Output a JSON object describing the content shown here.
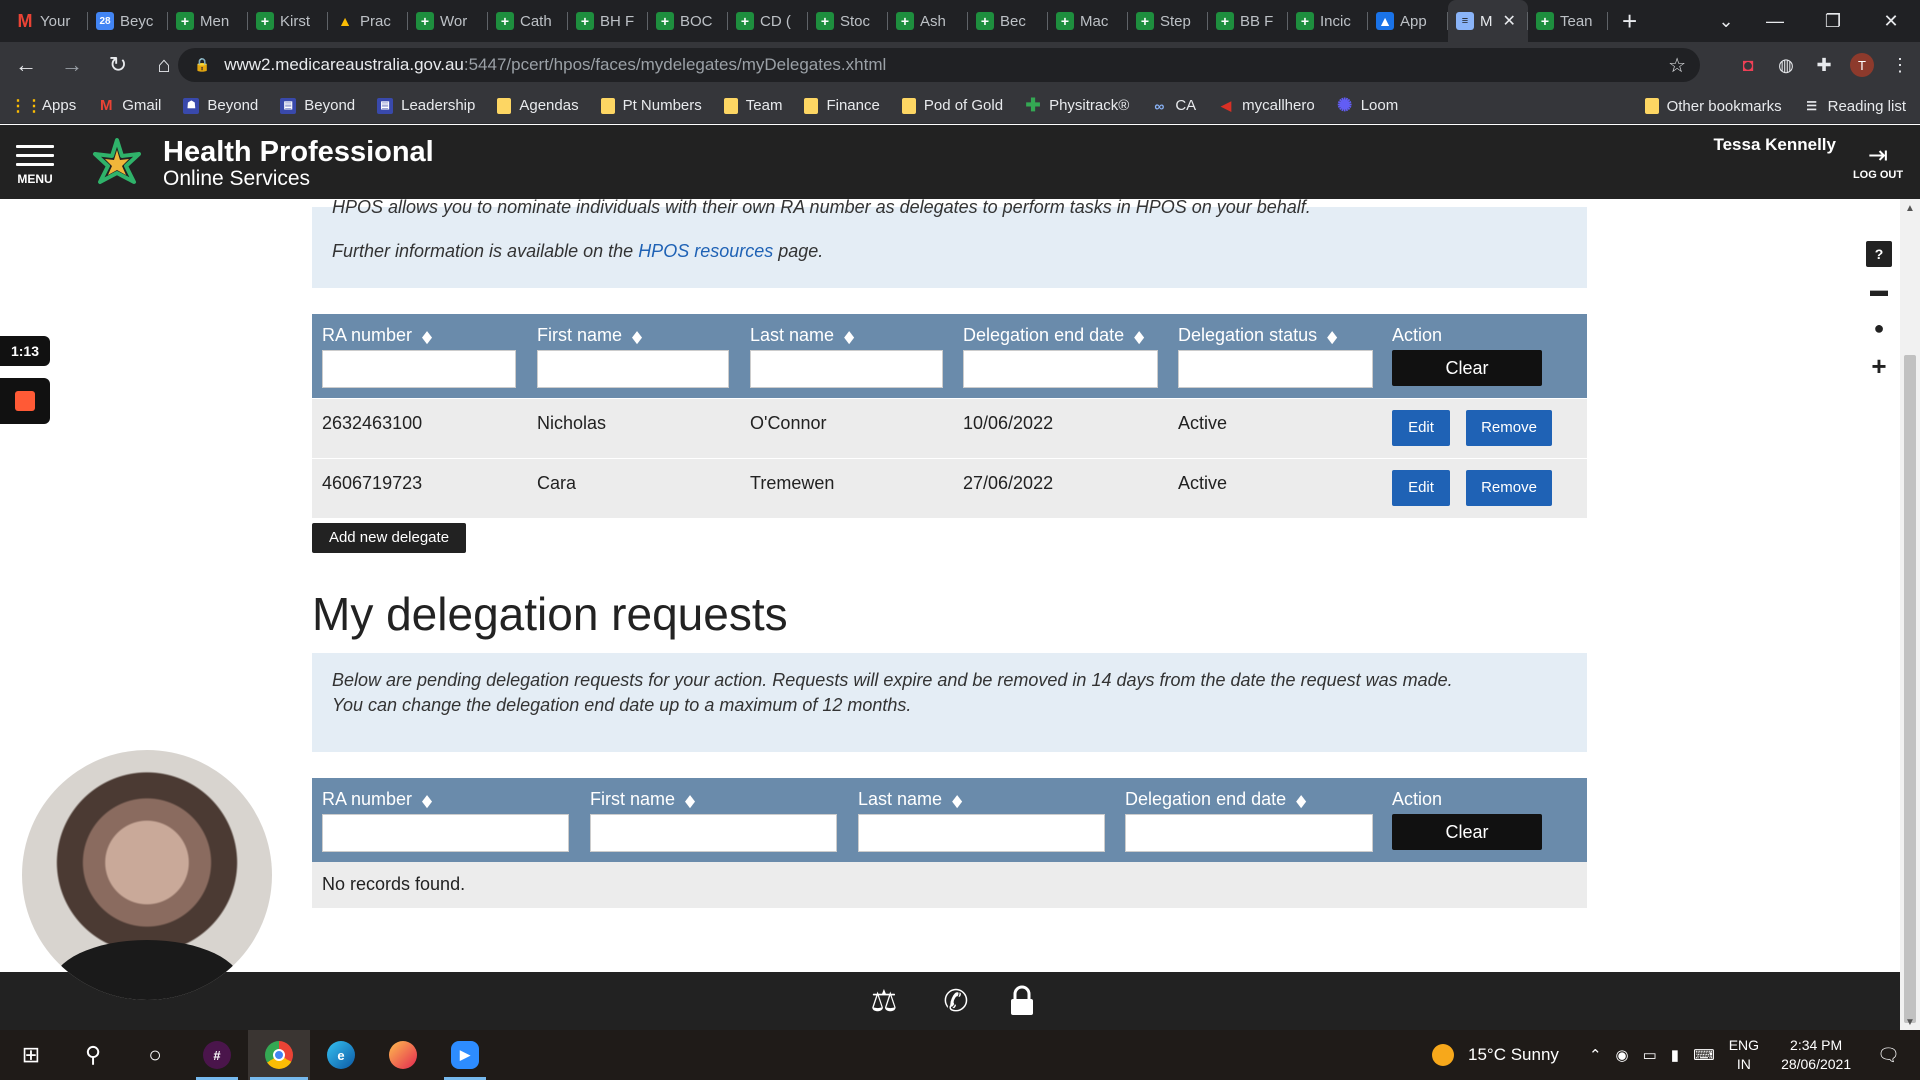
{
  "browser": {
    "tabs": [
      {
        "title": "Your",
        "icon": "gmail-icon"
      },
      {
        "title": "Beyc",
        "icon": "calendar-icon"
      },
      {
        "title": "Men",
        "icon": "cliniko-icon"
      },
      {
        "title": "Kirst",
        "icon": "cliniko-icon"
      },
      {
        "title": "Prac",
        "icon": "drive-icon"
      },
      {
        "title": "Wor",
        "icon": "cliniko-icon"
      },
      {
        "title": "Cath",
        "icon": "cliniko-icon"
      },
      {
        "title": "BH F",
        "icon": "cliniko-icon"
      },
      {
        "title": "BOC",
        "icon": "cliniko-icon"
      },
      {
        "title": "CD (",
        "icon": "cliniko-icon"
      },
      {
        "title": "Stoc",
        "icon": "cliniko-icon"
      },
      {
        "title": "Ash",
        "icon": "cliniko-icon"
      },
      {
        "title": "Bec",
        "icon": "cliniko-icon"
      },
      {
        "title": "Mac",
        "icon": "cliniko-icon"
      },
      {
        "title": "Step",
        "icon": "cliniko-icon"
      },
      {
        "title": "BB F",
        "icon": "cliniko-icon"
      },
      {
        "title": "Incic",
        "icon": "cliniko-icon"
      },
      {
        "title": "App",
        "icon": "app-icon"
      },
      {
        "title": "M",
        "icon": "document-icon",
        "active": true
      },
      {
        "title": "Tean",
        "icon": "cliniko-icon"
      }
    ],
    "url_host": "www2.medicareaustralia.gov.au",
    "url_path": ":5447/pcert/hpos/faces/mydelegates/myDelegates.xhtml",
    "bookmarks": [
      {
        "label": "Apps",
        "icon": "grid-icon"
      },
      {
        "label": "Gmail",
        "icon": "gmail-icon"
      },
      {
        "label": "Beyond",
        "icon": "person-icon"
      },
      {
        "label": "Beyond",
        "icon": "form-icon"
      },
      {
        "label": "Leadership",
        "icon": "form-icon"
      },
      {
        "label": "Agendas",
        "icon": "folder-icon"
      },
      {
        "label": "Pt Numbers",
        "icon": "folder-icon"
      },
      {
        "label": "Team",
        "icon": "folder-icon"
      },
      {
        "label": "Finance",
        "icon": "folder-icon"
      },
      {
        "label": "Pod of Gold",
        "icon": "folder-icon"
      },
      {
        "label": "Physitrack®",
        "icon": "physitrack-icon"
      },
      {
        "label": "CA",
        "icon": "ca-icon"
      },
      {
        "label": "mycallhero",
        "icon": "callhero-icon"
      },
      {
        "label": "Loom",
        "icon": "loom-icon"
      }
    ],
    "other_bookmarks": "Other bookmarks",
    "reading_list": "Reading list",
    "profile_initial": "T"
  },
  "hpos": {
    "menu_label": "MENU",
    "brand_line1": "Health Professional",
    "brand_line2": "Online Services",
    "user_name": "Tessa Kennelly",
    "logout_label": "LOG OUT",
    "intro_cut": "HPOS allows you to nominate individuals with their own RA number as delegates to perform tasks in HPOS on your behalf.",
    "further_prefix": "Further information is available on the",
    "further_link": "HPOS resources",
    "further_suffix": "page.",
    "delegates_table": {
      "headers": [
        "RA number",
        "First name",
        "Last name",
        "Delegation end date",
        "Delegation status",
        "Action"
      ],
      "clear_label": "Clear",
      "rows": [
        {
          "ra": "2632463100",
          "first": "Nicholas",
          "last": "O'Connor",
          "end_date": "10/06/2022",
          "status": "Active"
        },
        {
          "ra": "4606719723",
          "first": "Cara",
          "last": "Tremewen",
          "end_date": "27/06/2022",
          "status": "Active"
        }
      ],
      "edit_label": "Edit",
      "remove_label": "Remove"
    },
    "add_delegate_label": "Add new delegate",
    "requests_heading": "My delegation requests",
    "requests_notice_line1": "Below are pending delegation requests for your action. Requests will expire and be removed in 14 days from the date the request was made.",
    "requests_notice_line2": "You can change the delegation end date up to a maximum of 12 months.",
    "requests_table": {
      "headers": [
        "RA number",
        "First name",
        "Last name",
        "Delegation end date",
        "Action"
      ],
      "clear_label": "Clear",
      "empty_text": "No records found."
    }
  },
  "recording": {
    "elapsed": "1:13"
  },
  "taskbar": {
    "weather": "15°C  Sunny",
    "lang_line1": "ENG",
    "lang_line2": "IN",
    "time": "2:34 PM",
    "date": "28/06/2021"
  },
  "colors": {
    "table_header": "#6a8bab",
    "notice_bg": "#e4edf5",
    "primary_button": "#1f62b5",
    "header_bg": "#222222"
  }
}
